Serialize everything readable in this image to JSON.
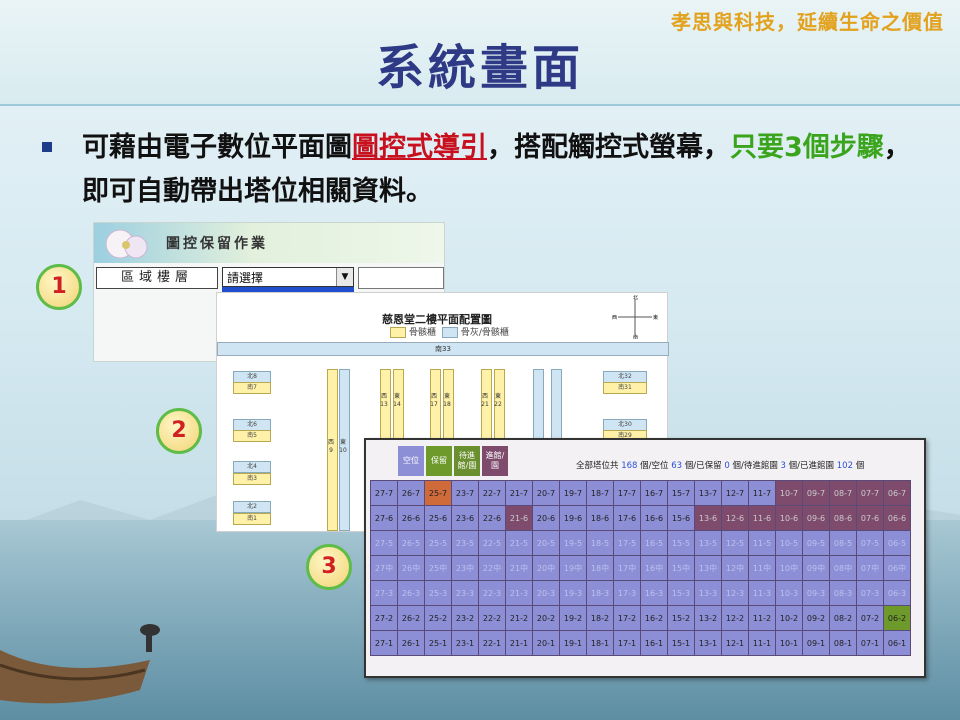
{
  "slogan": "孝思與科技，延續生命之價值",
  "title": "系統畫面",
  "bullet": {
    "part1": "可藉由電子數位平面圖",
    "highlight1": "圖控式導引",
    "part2": "，搭配觸控式螢幕，",
    "highlight2": "只要3個步驟",
    "part3": "，即可自動帶出塔位相關資料。"
  },
  "steps": [
    "1",
    "2",
    "3"
  ],
  "screen1": {
    "title": "圖控保留作業",
    "area_label": "區域樓層",
    "select_value": "請選擇"
  },
  "screen2": {
    "title": "慈恩堂二樓平面配置圖",
    "legend": [
      "骨骸櫃",
      "骨灰/骨骸櫃"
    ],
    "compass": {
      "n": "北",
      "s": "南",
      "w": "西",
      "e": "東"
    },
    "top_label": "南33",
    "blocks": [
      "北8",
      "南7",
      "北6",
      "南5",
      "北4",
      "南3",
      "北2",
      "南1",
      "北32",
      "南31",
      "北30",
      "南29"
    ],
    "vlabels": [
      [
        "西",
        "9"
      ],
      [
        "東",
        "10"
      ],
      [
        "西",
        "13"
      ],
      [
        "東",
        "14"
      ],
      [
        "西",
        "17"
      ],
      [
        "東",
        "18"
      ],
      [
        "西",
        "21"
      ],
      [
        "東",
        "22"
      ]
    ]
  },
  "screen3": {
    "legend": [
      {
        "label": "空位",
        "color": "#8d8fd6"
      },
      {
        "label": "保留",
        "color": "#6d9a2a"
      },
      {
        "label": "待進館/園",
        "color": "#6a8f2f"
      },
      {
        "label": "進館/園",
        "color": "#7e4b6d"
      }
    ],
    "summary": {
      "prefix": "全部塔位共",
      "total": "168",
      "t1": "個/空位",
      "empty": "63",
      "t2": "個/已保留",
      "reserved": "0",
      "t3": "個/待進館園",
      "pending": "3",
      "t4": "個/已進館園",
      "entered": "102",
      "t5": "個"
    },
    "rows": [
      {
        "level": "7",
        "types": "nnonnnnnnnnnnnnrrrrr",
        "fl": false
      },
      {
        "level": "6",
        "types": "nnnnnrnnnnnnrrrrrrrr",
        "fl": false
      },
      {
        "level": "5",
        "types": "ffffffffffffffffffff",
        "fl": true
      },
      {
        "level": "4",
        "types": "ffffffffffffffffffff",
        "fl": true
      },
      {
        "level": "3",
        "types": "ffffffffffffffffffff",
        "fl": true
      },
      {
        "level": "2",
        "types": "nnnnnnnnnnnnnnnnnnnggg",
        "fl": false
      },
      {
        "level": "1",
        "types": "nnnnnnnnnnnnnnnnnnnnggr",
        "fl": false
      }
    ],
    "columns": [
      "27",
      "26",
      "25",
      "23",
      "22",
      "21",
      "20",
      "19",
      "18",
      "17",
      "16",
      "15",
      "13",
      "12",
      "11",
      "10",
      "09",
      "08",
      "07",
      "06"
    ],
    "row4_suffix": "中"
  }
}
